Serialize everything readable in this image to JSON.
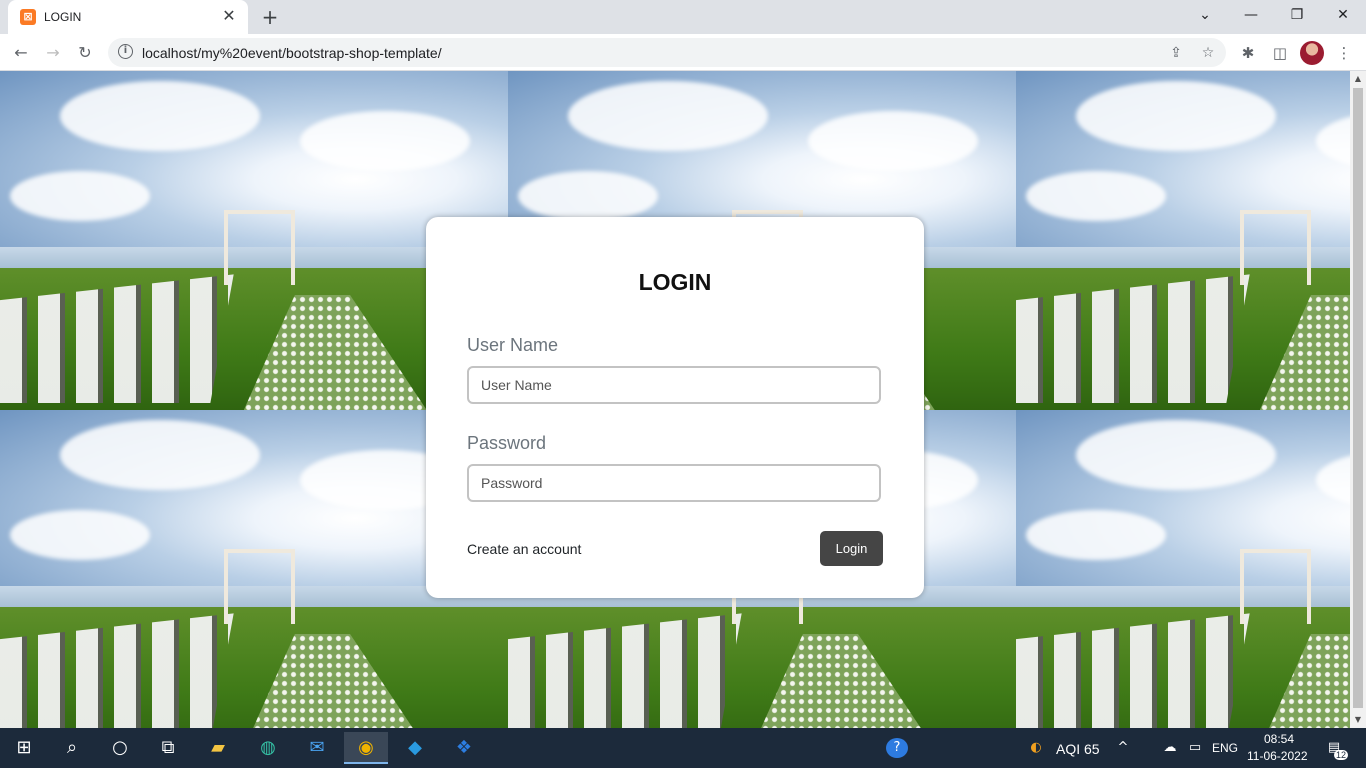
{
  "browser": {
    "tab_title": "LOGIN",
    "favicon_glyph": "⊠",
    "close_glyph": "✕",
    "new_tab_glyph": "+",
    "url": "localhost/my%20event/bootstrap-shop-template/",
    "window_controls": {
      "tab_search": "⌄",
      "minimize": "—",
      "restore": "❐",
      "close": "✕"
    },
    "nav": {
      "back": "←",
      "forward": "→",
      "reload": "↻"
    },
    "omnibox_icons": {
      "share": "⇪",
      "bookmark": "☆"
    },
    "toolbar_icons": {
      "extensions": "✱",
      "side_panel": "◫",
      "menu": "⋮"
    }
  },
  "login": {
    "title": "LOGIN",
    "username_label": "User Name",
    "username_placeholder": "User Name",
    "password_label": "Password",
    "password_placeholder": "Password",
    "create_account": "Create an account",
    "login_button": "Login"
  },
  "scrollbar": {
    "up": "▲",
    "down": "▼"
  },
  "taskbar": {
    "icons": {
      "start": "⊞",
      "search": "⌕",
      "cortana": "○",
      "task_view": "⧉",
      "file_explorer": "▰",
      "edge": "◍",
      "mail": "✉",
      "chrome": "◉",
      "vscode": "◆",
      "dropbox": "❖",
      "help": "?",
      "weather": "◐",
      "chevron_up": "^",
      "wifi": "☁",
      "battery": "▭",
      "notifications": "▤"
    },
    "aqi": "AQI 65",
    "language": "ENG",
    "time": "08:54",
    "date": "11-06-2022",
    "notification_count": "12"
  }
}
